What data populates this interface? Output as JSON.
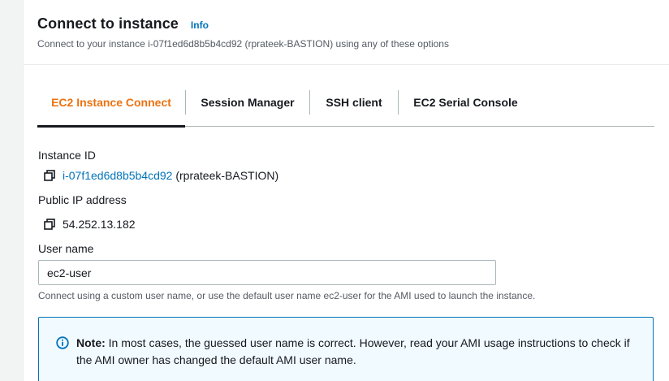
{
  "header": {
    "title": "Connect to instance",
    "info_label": "Info",
    "subtitle": "Connect to your instance i-07f1ed6d8b5b4cd92 (rprateek-BASTION) using any of these options"
  },
  "tabs": [
    {
      "label": "EC2 Instance Connect",
      "active": true
    },
    {
      "label": "Session Manager",
      "active": false
    },
    {
      "label": "SSH client",
      "active": false
    },
    {
      "label": "EC2 Serial Console",
      "active": false
    }
  ],
  "instance": {
    "label": "Instance ID",
    "id": "i-07f1ed6d8b5b4cd92",
    "name_suffix": " (rprateek-BASTION)"
  },
  "public_ip": {
    "label": "Public IP address",
    "value": "54.252.13.182"
  },
  "username": {
    "label": "User name",
    "value": "ec2-user",
    "hint": "Connect using a custom user name, or use the default user name ec2-user for the AMI used to launch the instance."
  },
  "alert": {
    "title": "Note:",
    "text": " In most cases, the guessed user name is correct. However, read your AMI usage instructions to check if the AMI owner has changed the default AMI user name."
  },
  "colors": {
    "accent_link": "#0073bb",
    "active_tab": "#ec7211",
    "alert_bg": "#f1faff"
  },
  "icons": [
    "copy-icon",
    "info-circle-icon"
  ]
}
